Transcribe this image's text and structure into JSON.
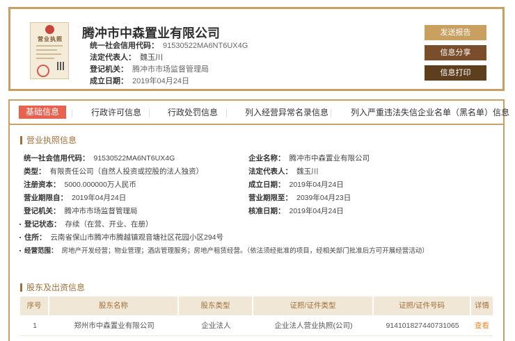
{
  "header": {
    "company_name": "腾冲市中森置业有限公司",
    "license_thumb_title": "营业执照",
    "credit_code_label": "统一社会信用代码：",
    "credit_code": "91530522MA6NT6UX4G",
    "legal_rep_label": "法定代表人：",
    "legal_rep": "魏玉川",
    "authority_label": "登记机关：",
    "authority": "腾冲市市场监督管理局",
    "founded_label": "成立日期：",
    "founded": "2019年04月24日",
    "buttons": {
      "report": "发送报告",
      "share": "信息分享",
      "print": "信息打印"
    }
  },
  "tabs": [
    {
      "label": "基础信息"
    },
    {
      "label": "行政许可信息"
    },
    {
      "label": "行政处罚信息"
    },
    {
      "label": "列入经营异常名录信息"
    },
    {
      "label": "列入严重违法失信企业名单（黑名单）信息"
    }
  ],
  "license_section": {
    "title": "营业执照信息",
    "fields": {
      "credit_code_label": "统一社会信用代码：",
      "credit_code": "91530522MA6NT6UX4G",
      "name_label": "企业名称：",
      "name": "腾冲市中森置业有限公司",
      "type_label": "类型：",
      "type": "有限责任公司（自然人投资或控股的法人独资）",
      "legal_rep_label": "法定代表人：",
      "legal_rep": "魏玉川",
      "capital_label": "注册资本：",
      "capital": "5000.000000万人民币",
      "founded_label": "成立日期：",
      "founded": "2019年04月24日",
      "term_from_label": "营业期限自：",
      "term_from": "2019年04月24日",
      "term_to_label": "营业期限至：",
      "term_to": "2039年04月23日",
      "authority_label": "登记机关：",
      "authority": "腾冲市市场监督管理局",
      "approved_label": "核准日期：",
      "approved": "2019年04月24日",
      "status_label": "登记状态：",
      "status": "存续（在营、开业、在册）",
      "address_label": "住所：",
      "address": "云南省保山市腾冲市腾越镇观音塘社区花园小区294号",
      "scope_label": "经营范围：",
      "scope": "房地产开发经营；物业管理；酒店管理服务；房地产租赁经营。（依法须经批准的项目，经相关部门批准后方可开展经营活动）"
    }
  },
  "shareholder_section": {
    "title": "股东及出资信息",
    "columns": [
      "序号",
      "股东名称",
      "股东类型",
      "证照/证件类型",
      "证照/证件号码",
      "详情"
    ],
    "rows": [
      [
        "1",
        "郑州市中森置业有限公司",
        "企业法人",
        "企业法人营业执照(公司)",
        "914101827440731065",
        "查看"
      ]
    ]
  },
  "colors": {
    "accent_gold": "#c9a063",
    "active_tab": "#e8624f",
    "section_brown": "#a0703a",
    "link_orange": "#e88a2d"
  }
}
